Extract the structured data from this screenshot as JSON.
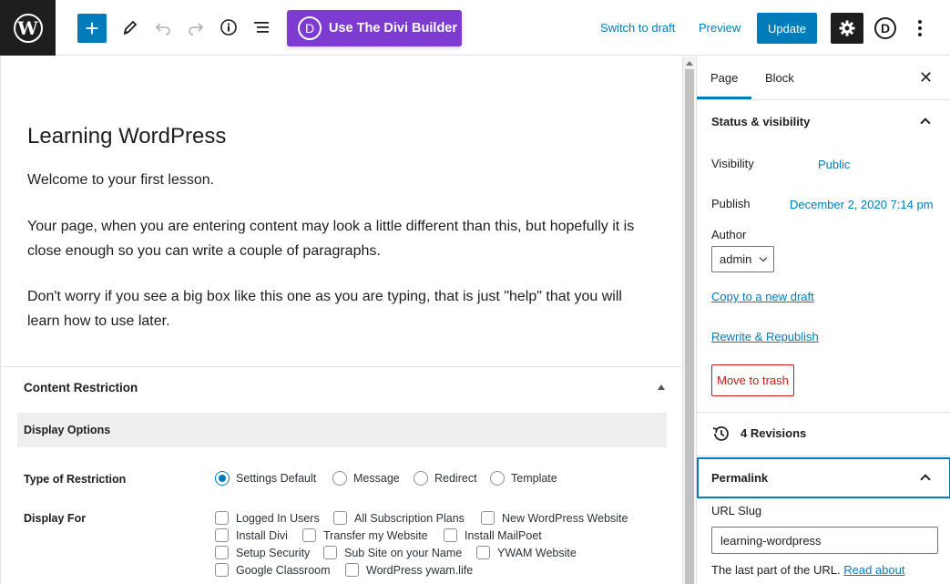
{
  "toolbar": {
    "divi_button_label": "Use The Divi Builder",
    "divi_letter": "D",
    "switch_to_draft": "Switch to draft",
    "preview": "Preview",
    "update": "Update",
    "add_symbol": "+"
  },
  "editor": {
    "title": "Learning WordPress",
    "paragraphs": [
      "Welcome to your first lesson.",
      "Your page, when you are entering content may look a little different than this, but hopefully it is close enough so you can write a couple of paragraphs.",
      "Don't worry if you see a big box like this one as you are typing, that is just \"help\" that you will learn how to use later."
    ]
  },
  "content_restriction": {
    "title": "Content Restriction",
    "display_options": "Display Options",
    "type_label": "Type of Restriction",
    "radios": [
      {
        "label": "Settings Default",
        "selected": true
      },
      {
        "label": "Message",
        "selected": false
      },
      {
        "label": "Redirect",
        "selected": false
      },
      {
        "label": "Template",
        "selected": false
      }
    ],
    "display_for_label": "Display For",
    "checkboxes": [
      "Logged In Users",
      "All Subscription Plans",
      "New WordPress Website",
      "Install Divi",
      "Transfer my Website",
      "Install MailPoet",
      "Setup Security",
      "Sub Site on your Name",
      "YWAM Website",
      "Google Classroom",
      "WordPress ywam.life"
    ]
  },
  "sidebar": {
    "tabs": [
      "Page",
      "Block"
    ],
    "close_symbol": "✕",
    "status_title": "Status & visibility",
    "visibility_label": "Visibility",
    "visibility_value": "Public",
    "publish_label": "Publish",
    "publish_value": "December 2, 2020 7:14 pm",
    "author_label": "Author",
    "author_value": "admin",
    "copy_draft": "Copy to a new draft",
    "rewrite": "Rewrite & Republish",
    "trash": "Move to trash",
    "revisions": "4 Revisions",
    "permalink_title": "Permalink",
    "url_slug_label": "URL Slug",
    "url_slug_value": "learning-wordpress",
    "url_help": "The last part of the URL.",
    "url_help_link": "Read about"
  },
  "colors": {
    "accent": "#007cba",
    "divi_purple": "#7e3bd0",
    "danger": "#cc1818"
  }
}
